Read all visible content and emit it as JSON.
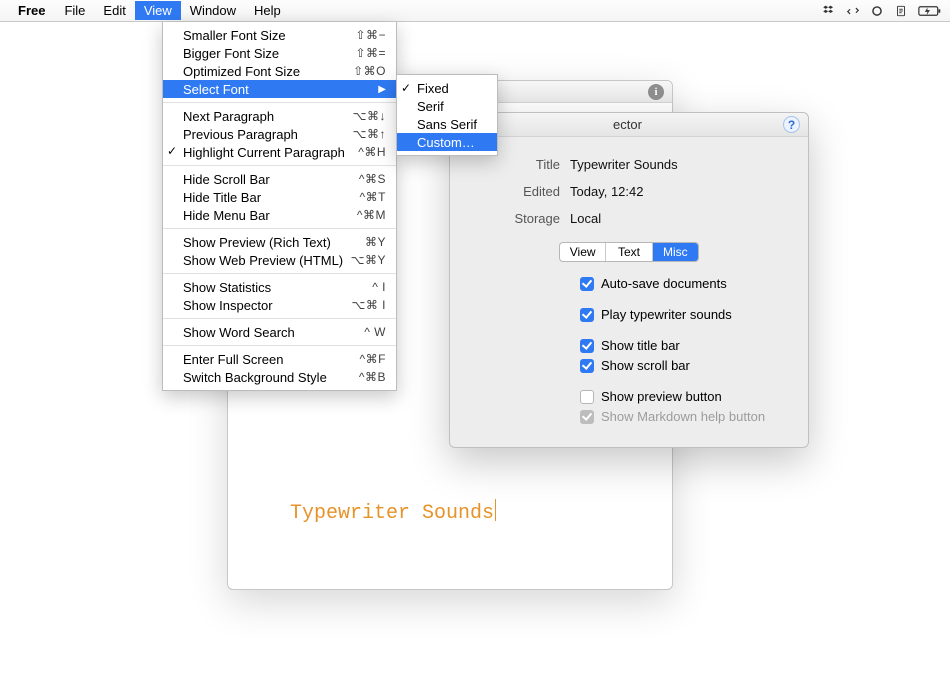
{
  "menubar": {
    "app_name": "Free",
    "items": [
      "File",
      "Edit",
      "View",
      "Window",
      "Help"
    ],
    "active_index": 2
  },
  "view_menu": {
    "groups": [
      [
        {
          "label": "Smaller Font Size",
          "shortcut": "⇧⌘−"
        },
        {
          "label": "Bigger Font Size",
          "shortcut": "⇧⌘="
        },
        {
          "label": "Optimized Font Size",
          "shortcut": "⇧⌘O"
        },
        {
          "label": "Select Font",
          "highlight": true,
          "submenu": true
        }
      ],
      [
        {
          "label": "Next Paragraph",
          "shortcut": "⌥⌘↓"
        },
        {
          "label": "Previous Paragraph",
          "shortcut": "⌥⌘↑"
        },
        {
          "label": "Highlight Current Paragraph",
          "shortcut": "^⌘H",
          "checked": true
        }
      ],
      [
        {
          "label": "Hide Scroll Bar",
          "shortcut": "^⌘S"
        },
        {
          "label": "Hide Title Bar",
          "shortcut": "^⌘T"
        },
        {
          "label": "Hide Menu Bar",
          "shortcut": "^⌘M"
        }
      ],
      [
        {
          "label": "Show Preview (Rich Text)",
          "shortcut": "⌘Y"
        },
        {
          "label": "Show Web Preview (HTML)",
          "shortcut": "⌥⌘Y"
        }
      ],
      [
        {
          "label": "Show Statistics",
          "shortcut": "^ I"
        },
        {
          "label": "Show Inspector",
          "shortcut": "⌥⌘ I"
        }
      ],
      [
        {
          "label": "Show Word Search",
          "shortcut": "^ W"
        }
      ],
      [
        {
          "label": "Enter Full Screen",
          "shortcut": "^⌘F"
        },
        {
          "label": "Switch Background Style",
          "shortcut": "^⌘B"
        }
      ]
    ]
  },
  "submenu_font": {
    "items": [
      {
        "label": "Fixed",
        "checked": true
      },
      {
        "label": "Serif"
      },
      {
        "label": "Sans Serif"
      },
      {
        "label": "Custom…",
        "highlight": true
      }
    ]
  },
  "editor": {
    "document_text": "Typewriter Sounds"
  },
  "inspector": {
    "title_suffix": "ector",
    "fields": {
      "title_label": "Title",
      "title_value": "Typewriter Sounds",
      "edited_label": "Edited",
      "edited_value": "Today, 12:42",
      "storage_label": "Storage",
      "storage_value": "Local"
    },
    "segments": [
      "View",
      "Text",
      "Misc"
    ],
    "active_segment": 2,
    "options": [
      {
        "label": "Auto-save documents",
        "checked": true,
        "gap_after": true
      },
      {
        "label": "Play typewriter sounds",
        "checked": true,
        "gap_after": true
      },
      {
        "label": "Show title bar",
        "checked": true
      },
      {
        "label": "Show scroll bar",
        "checked": true,
        "gap_after": true
      },
      {
        "label": "Show preview button",
        "checked": false
      },
      {
        "label": "Show Markdown help button",
        "checked": true,
        "disabled": true
      }
    ]
  }
}
